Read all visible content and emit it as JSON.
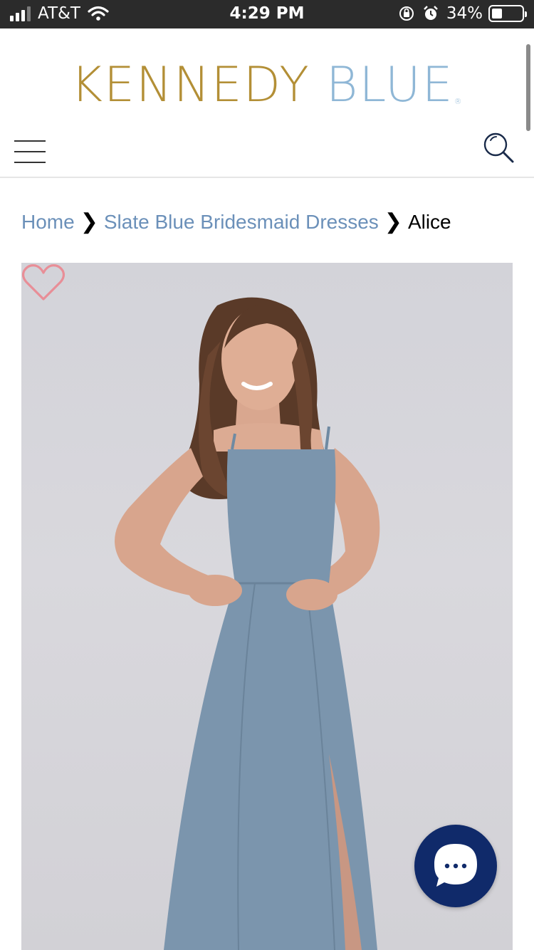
{
  "status_bar": {
    "carrier": "AT&T",
    "time": "4:29 PM",
    "battery_percent": "34%",
    "battery_level": 0.34,
    "icons": [
      "signal-icon",
      "wifi-icon",
      "orientation-lock-icon",
      "alarm-icon",
      "battery-icon"
    ]
  },
  "header": {
    "logo_part1": "KENNEDY",
    "logo_part2": "BLUE",
    "logo_registered": "®",
    "icons": [
      "hamburger-menu-icon",
      "search-icon"
    ]
  },
  "breadcrumb": {
    "home": "Home",
    "category": "Slate Blue Bridesmaid Dresses",
    "current": "Alice"
  },
  "product": {
    "wishlist_icon": "heart-outline-icon",
    "colors": {
      "dress": "#7b95ad",
      "wishlist": "#e88e97"
    }
  },
  "chat": {
    "icon": "chat-bubble-icon"
  },
  "colors": {
    "brand_gold": "#b38f36",
    "brand_blue": "#8fb7d6",
    "link": "#6b90b9",
    "chat_bg": "#102a6a"
  }
}
